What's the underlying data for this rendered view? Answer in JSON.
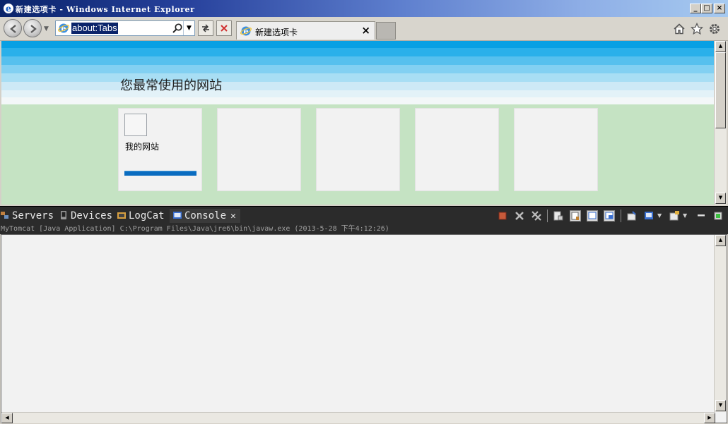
{
  "window": {
    "title": "新建选项卡 - Windows Internet Explorer",
    "controls": {
      "minimize": "_",
      "maximize": "□",
      "close": "×"
    }
  },
  "toolbar": {
    "address": "about:Tabs",
    "tab_label": "新建选项卡",
    "tab_close": "×",
    "drop_glyph": "▼"
  },
  "new_tab_page": {
    "section_title": "您最常使用的网站",
    "tiles": [
      {
        "label": "我的网站",
        "has_thumbnail": true,
        "activity_level": 1.0
      },
      {
        "label": ""
      },
      {
        "label": ""
      },
      {
        "label": ""
      },
      {
        "label": ""
      }
    ]
  },
  "eclipse": {
    "views": [
      {
        "label": "Servers",
        "icon": "servers-icon"
      },
      {
        "label": "Devices",
        "icon": "devices-icon"
      },
      {
        "label": "LogCat",
        "icon": "logcat-icon"
      },
      {
        "label": "Console",
        "icon": "console-icon",
        "active": true
      }
    ],
    "close_glyph": "✕",
    "process_line": "MyTomcat [Java Application] C:\\Program Files\\Java\\jre6\\bin\\javaw.exe (2013-5-28 下午4:12:26)"
  },
  "colors": {
    "accent": "#0a6cc0",
    "content_bg": "#c5e3c3",
    "eclipse_dark": "#2b2b2b",
    "terminate_red": "#c0392b"
  }
}
